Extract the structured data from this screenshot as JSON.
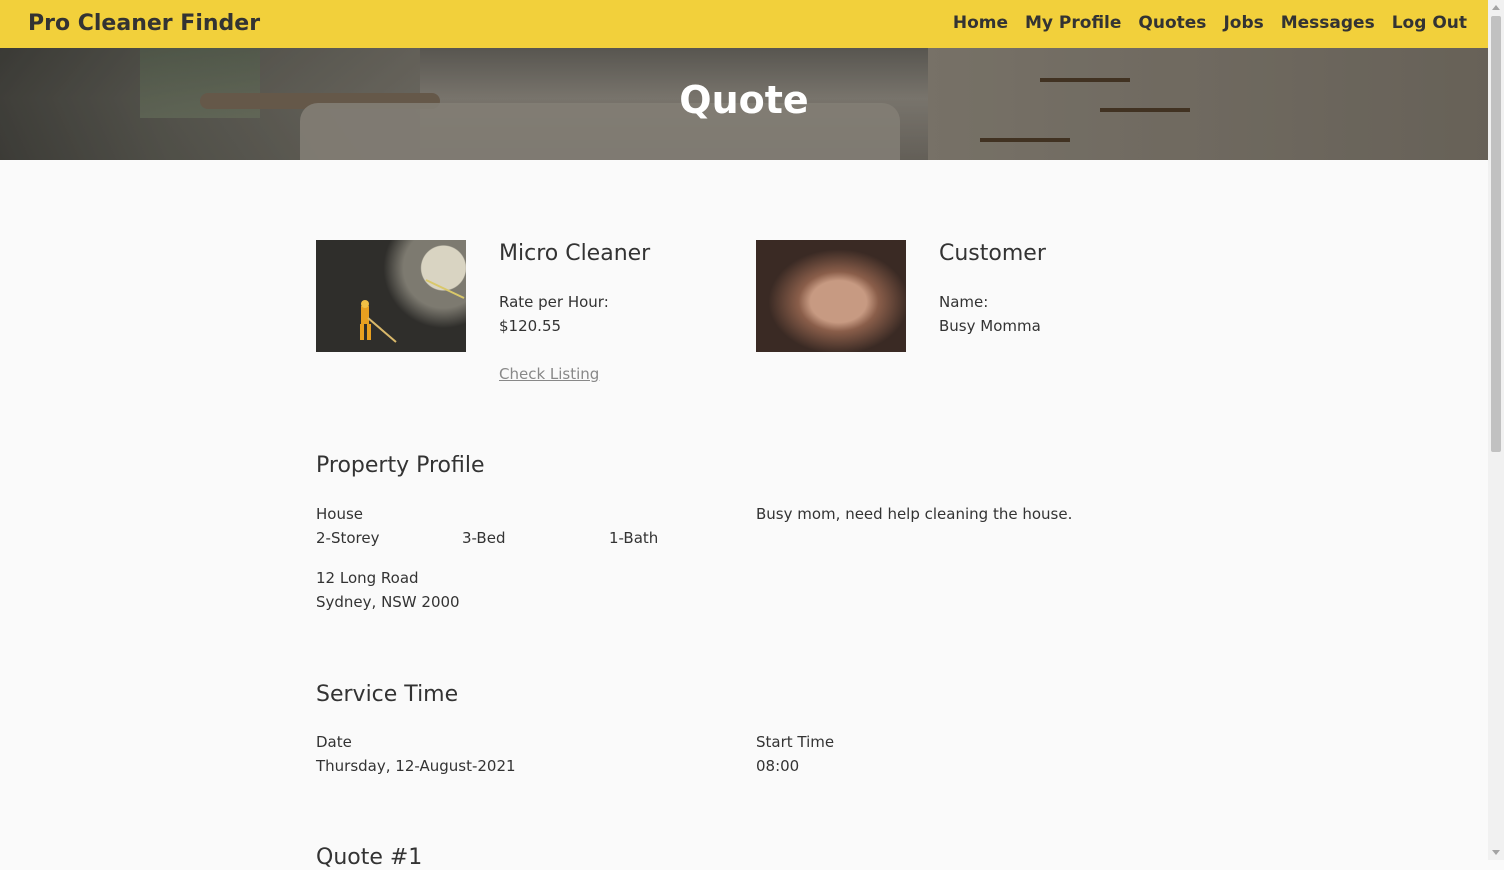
{
  "header": {
    "brand": "Pro Cleaner Finder",
    "nav": [
      "Home",
      "My Profile",
      "Quotes",
      "Jobs",
      "Messages",
      "Log Out"
    ]
  },
  "hero": {
    "title": "Quote"
  },
  "cleaner": {
    "name": "Micro Cleaner",
    "rate_label": "Rate per Hour:",
    "rate_value": "$120.55",
    "listing_link": "Check Listing"
  },
  "customer": {
    "heading": "Customer",
    "name_label": "Name:",
    "name_value": "Busy Momma"
  },
  "property": {
    "heading": "Property Profile",
    "type": "House",
    "storeys": "2-Storey",
    "beds": "3-Bed",
    "baths": "1-Bath",
    "address_line1": "12 Long Road",
    "address_line2": "Sydney, NSW 2000",
    "description": "Busy mom, need help cleaning the house."
  },
  "service_time": {
    "heading": "Service Time",
    "date_label": "Date",
    "date_value": "Thursday, 12-August-2021",
    "start_label": "Start Time",
    "start_value": "08:00"
  },
  "quote": {
    "heading": "Quote #1"
  }
}
